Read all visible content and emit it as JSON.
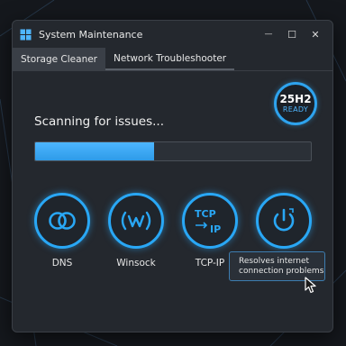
{
  "window": {
    "title": "System Maintenance",
    "minimize_glyph": "—",
    "maximize_glyph": "☐",
    "close_glyph": "✕"
  },
  "tabs": [
    {
      "label": "Storage Cleaner",
      "active": true
    },
    {
      "label": "Network Troubleshooter",
      "active": false
    }
  ],
  "badge": {
    "main": "25H2",
    "sub": "READY"
  },
  "scan": {
    "status": "Scanning for issues...",
    "progress_fraction": 0.43
  },
  "tools": [
    {
      "label": "DNS",
      "icon": "linked-rings-icon"
    },
    {
      "label": "Winsock",
      "icon": "wireless-w-icon"
    },
    {
      "label": "TCP-IP",
      "icon": "tcp-ip-arrows-icon"
    },
    {
      "label": "Reset",
      "icon": "power-reset-icon"
    }
  ],
  "tooltip": {
    "line1": "Resolves internet",
    "line2": "connection problems"
  },
  "colors": {
    "accent": "#29a7f5",
    "window_bg": "#24282e",
    "desktop_bg": "#15181d"
  }
}
